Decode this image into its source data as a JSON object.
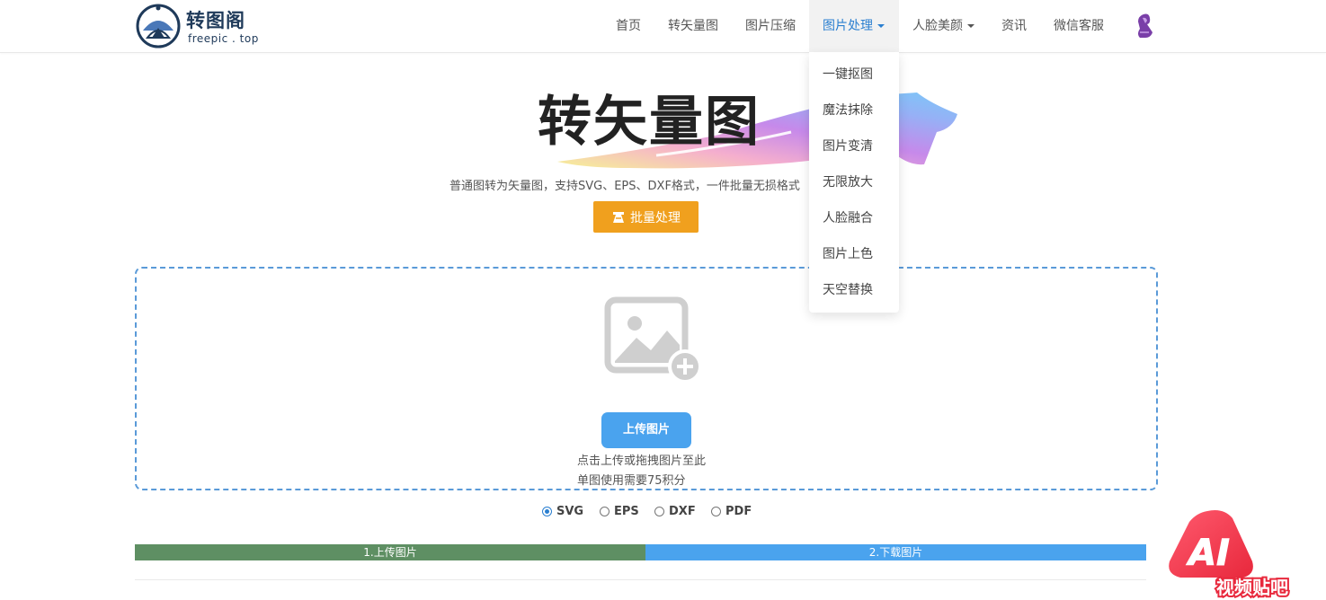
{
  "brand": {
    "name_cn": "转图阁",
    "name_en": "freepic . top"
  },
  "nav": {
    "items": [
      {
        "label": "首页"
      },
      {
        "label": "转矢量图"
      },
      {
        "label": "图片压缩"
      },
      {
        "label": "图片处理",
        "active": true
      },
      {
        "label": "人脸美颜"
      },
      {
        "label": "资讯"
      },
      {
        "label": "微信客服"
      }
    ]
  },
  "dropdown": {
    "items": [
      "一键抠图",
      "魔法抹除",
      "图片变清",
      "无限放大",
      "人脸融合",
      "图片上色",
      "天空替换"
    ]
  },
  "hero": {
    "title": "转矢量图",
    "subtitle": "普通图转为矢量图，支持SVG、EPS、DXF格式，一件批量无损格式"
  },
  "batch_button": {
    "label": "批量处理",
    "icon": "batch-icon"
  },
  "upload": {
    "button_label": "上传图片",
    "hint_1": "点击上传或拖拽图片至此",
    "hint_2": "单图使用需要75积分",
    "icon": "image-add-icon"
  },
  "formats": {
    "options": [
      "SVG",
      "EPS",
      "DXF",
      "PDF"
    ],
    "selected": "SVG"
  },
  "steps": [
    "1.上传图片",
    "2.下载图片"
  ],
  "watermark": {
    "text": "视频贴吧",
    "letters": "AI"
  },
  "colors": {
    "accent": "#2a7fd0",
    "batch": "#f0a01e",
    "upload_button": "#4aa3ee",
    "step1": "#5e8f63",
    "step2": "#4aa3ee",
    "dashed_border": "#5a9ad8"
  }
}
